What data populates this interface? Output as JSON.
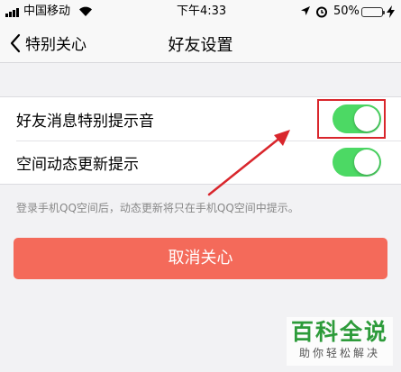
{
  "status_bar": {
    "carrier": "中国移动",
    "time": "下午4:33",
    "battery_percent": "50%",
    "battery_level": 0.5,
    "battery_color": "#4cd964",
    "icons": [
      "signal-icon",
      "wifi-icon",
      "location-arrow-icon",
      "alarm-icon",
      "battery-icon",
      "charging-bolt-icon"
    ]
  },
  "nav": {
    "back_label": "特别关心",
    "title": "好友设置"
  },
  "settings": {
    "items": [
      {
        "label": "好友消息特别提示音",
        "enabled": true
      },
      {
        "label": "空间动态更新提示",
        "enabled": true
      }
    ],
    "toggle_on_color": "#4cd964"
  },
  "hint": "登录手机QQ空间后，动态更新将只在手机QQ空间中提示。",
  "unfollow_button": {
    "label": "取消关心",
    "color": "#f46a5a"
  },
  "annotation": {
    "color": "#d9262c"
  },
  "watermark": {
    "title": "百科全说",
    "subtitle": "助你轻松解决"
  }
}
